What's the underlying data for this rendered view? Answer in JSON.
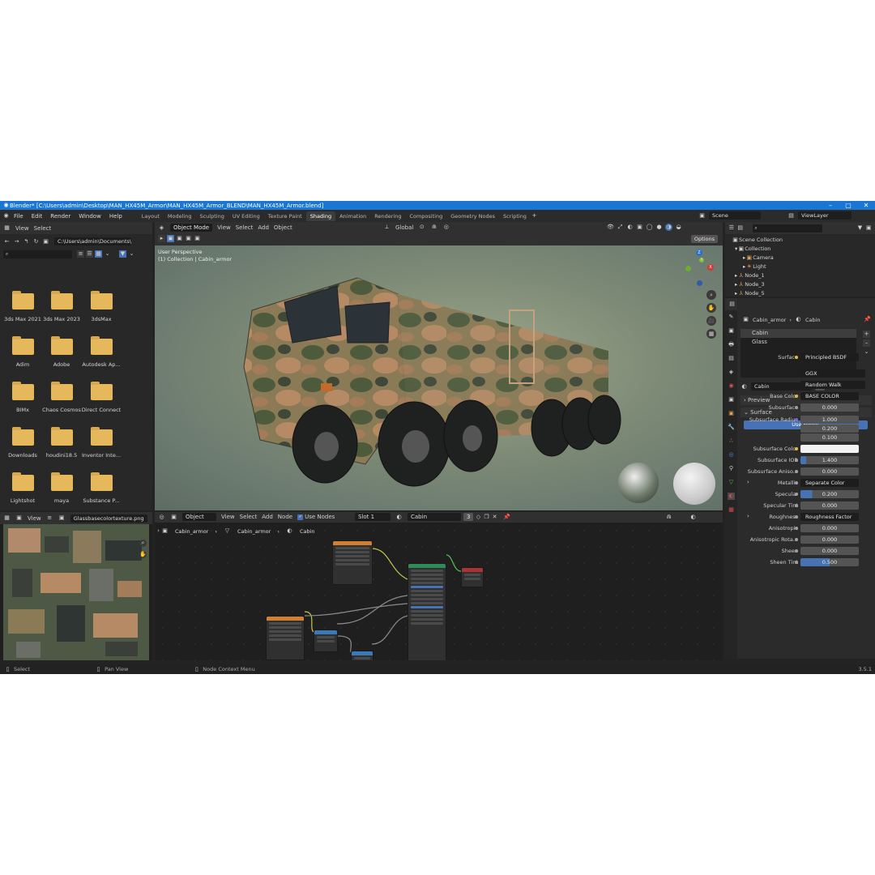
{
  "titlebar": {
    "title": "Blender* [C:\\Users\\admin\\Desktop\\MAN_HX45M_Armor\\MAN_HX45M_Armor_BLEND\\MAN_HX45M_Armor.blend]"
  },
  "menu": [
    "File",
    "Edit",
    "Render",
    "Window",
    "Help"
  ],
  "workspaces": [
    "Layout",
    "Modeling",
    "Sculpting",
    "UV Editing",
    "Texture Paint",
    "Shading",
    "Animation",
    "Rendering",
    "Compositing",
    "Geometry Nodes",
    "Scripting"
  ],
  "active_workspace": "Shading",
  "scene": "Scene",
  "view_layer": "ViewLayer",
  "file_browser": {
    "menu": [
      "View",
      "Select"
    ],
    "path": "C:\\Users\\admin\\Documents\\",
    "folders": [
      "3ds Max 2021",
      "3ds Max 2023",
      "3dsMax",
      "Adim",
      "Adobe",
      "Autodesk Ap...",
      "BIMx",
      "Chaos Cosmos",
      "Direct Connect",
      "Downloads",
      "houdini18.5",
      "Inventor Inte...",
      "Lightshot",
      "maya",
      "Substance P..."
    ]
  },
  "viewport": {
    "mode": "Object Mode",
    "menu": [
      "View",
      "Select",
      "Add",
      "Object"
    ],
    "transform": "Global",
    "options": "Options",
    "info_line1": "User Perspective",
    "info_line2": "(1) Collection | Cabin_armor",
    "axis_x": "X",
    "axis_y": "Y",
    "axis_z": "Z"
  },
  "image_editor": {
    "menu": "View",
    "image_name": "Glassbasecolortexture.png"
  },
  "node_editor": {
    "type": "Object",
    "menu": [
      "View",
      "Select",
      "Add",
      "Node"
    ],
    "use_nodes": "Use Nodes",
    "slot": "Slot 1",
    "material": "Cabin",
    "users": "3",
    "breadcrumb": [
      "Cabin_armor",
      "Cabin_armor",
      "Cabin"
    ]
  },
  "outliner": {
    "root": "Scene Collection",
    "items": [
      "Collection",
      "Camera",
      "Light",
      "Node_1",
      "Node_3",
      "Node_5"
    ]
  },
  "properties": {
    "object": "Cabin_armor",
    "material_tab": "Cabin",
    "slots": [
      "Cabin",
      "Glass"
    ],
    "material_name": "Cabin",
    "material_users": "3",
    "preview": "Preview",
    "surface": "Surface",
    "use_nodes_btn": "Use Nodes",
    "rows": [
      {
        "label": "Surface",
        "value": "Principled BSDF",
        "dark": true
      },
      {
        "label": "",
        "value": "GGX",
        "dark": true
      },
      {
        "label": "",
        "value": "Random Walk",
        "dark": true
      },
      {
        "label": "Base Color",
        "value": "BASE COLOR",
        "dark": true
      },
      {
        "label": "Subsurface",
        "value": "0.000",
        "dark": false
      },
      {
        "label": "Subsurface Radius",
        "value": "1.000",
        "dark": false
      },
      {
        "label": "",
        "value": "0.200",
        "dark": false
      },
      {
        "label": "",
        "value": "0.100",
        "dark": false
      },
      {
        "label": "Subsurface Color",
        "value": "",
        "dark": false
      },
      {
        "label": "Subsurface IOR",
        "value": "1.400",
        "dark": false
      },
      {
        "label": "Subsurface Aniso...",
        "value": "0.000",
        "dark": false
      },
      {
        "label": "Metallic",
        "value": "Separate Color",
        "dark": true
      },
      {
        "label": "Specular",
        "value": "0.200",
        "dark": false
      },
      {
        "label": "Specular Tint",
        "value": "0.000",
        "dark": false
      },
      {
        "label": "Roughness",
        "value": "Roughness Factor",
        "dark": true
      },
      {
        "label": "Anisotropic",
        "value": "0.000",
        "dark": false
      },
      {
        "label": "Anisotropic Rota...",
        "value": "0.000",
        "dark": false
      },
      {
        "label": "Sheen",
        "value": "0.000",
        "dark": false
      },
      {
        "label": "Sheen Tint",
        "value": "0.500",
        "dark": false
      }
    ]
  },
  "statusbar": {
    "select": "Select",
    "pan": "Pan View",
    "context": "Node Context Menu",
    "version": "3.5.1"
  },
  "colors": {
    "titlebar": "#1976d2",
    "accent": "#4772b3",
    "folder": "#e6b85c"
  }
}
